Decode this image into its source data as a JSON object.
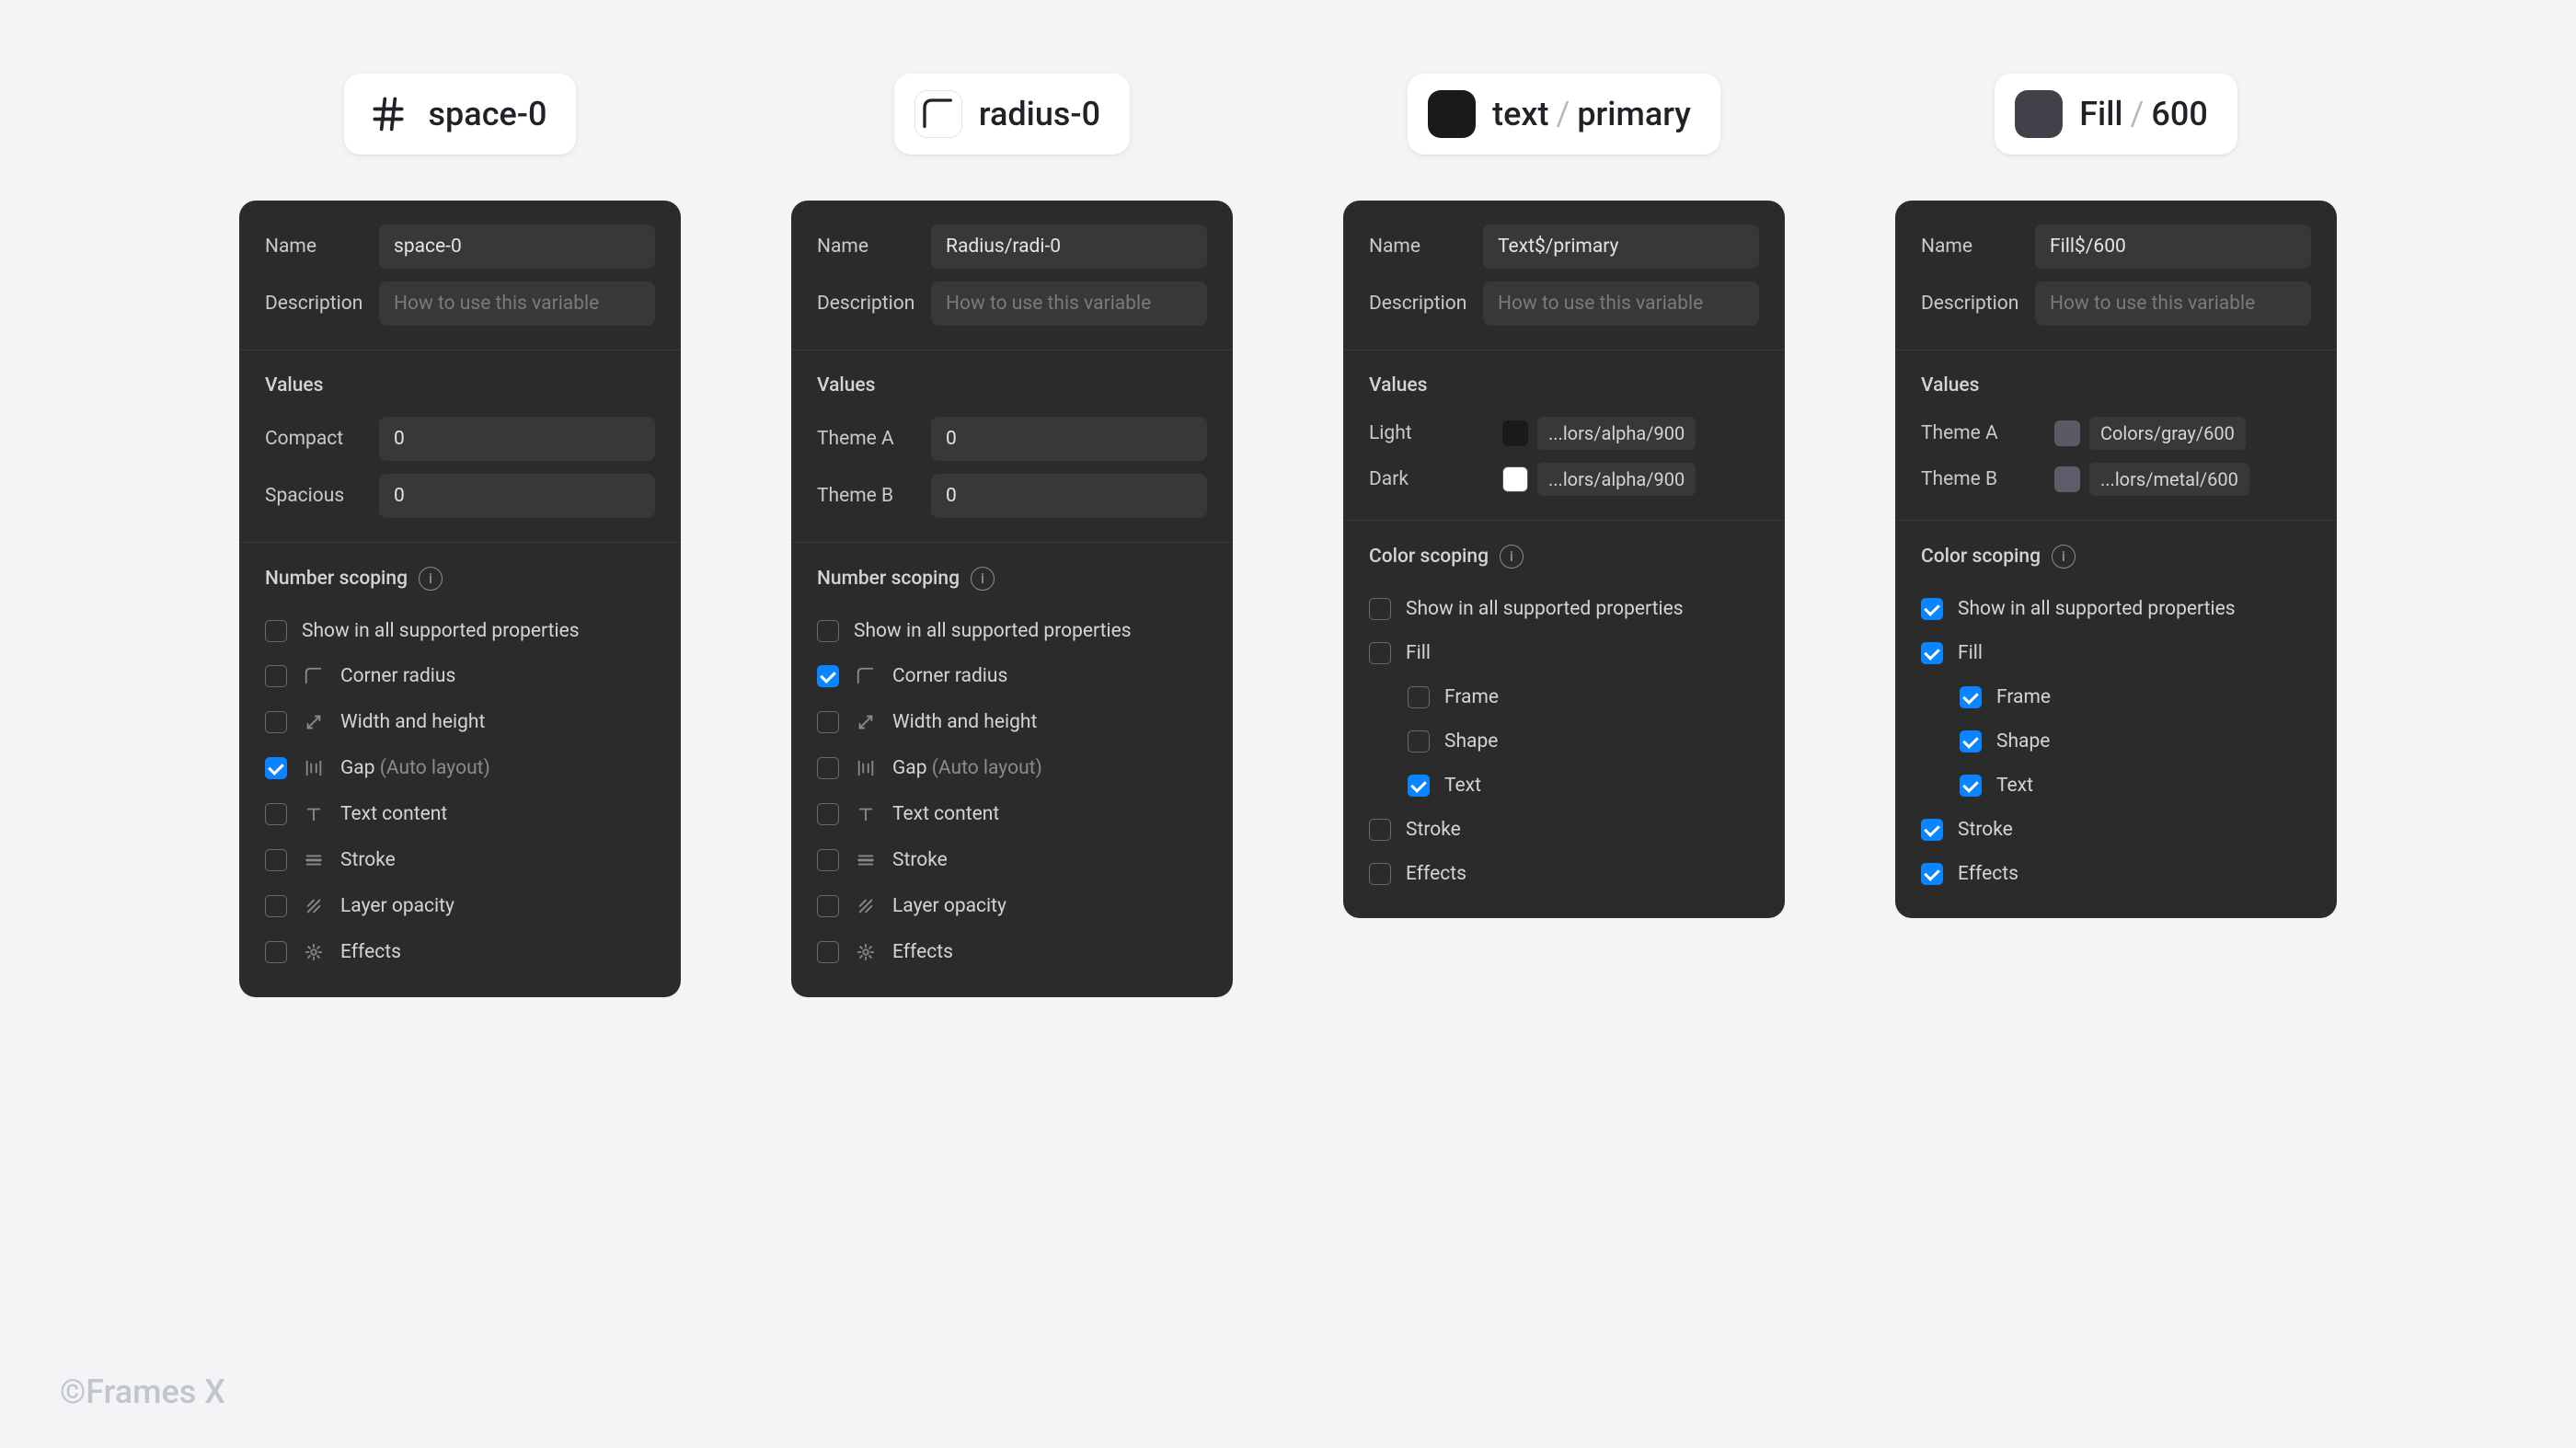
{
  "footer": "©Frames X",
  "common": {
    "nameLabel": "Name",
    "descLabel": "Description",
    "descPlaceholder": "How to use this variable",
    "valuesTitle": "Values",
    "numberScopingTitle": "Number scoping",
    "colorScopingTitle": "Color scoping",
    "showAllLabel": "Show in all supported properties",
    "cornerRadiusLabel": "Corner radius",
    "widthHeightLabel": "Width and height",
    "gapLabel": "Gap ",
    "gapMuted": "(Auto layout)",
    "textContentLabel": "Text content",
    "strokeLabel": "Stroke",
    "layerOpacityLabel": "Layer opacity",
    "effectsLabel": "Effects",
    "fillLabel": "Fill",
    "frameLabel": "Frame",
    "shapeLabel": "Shape",
    "textLabel": "Text"
  },
  "panels": [
    {
      "id": "space",
      "header": {
        "type": "hash",
        "text": "space-0"
      },
      "name": "space-0",
      "values": [
        {
          "label": "Compact",
          "value": "0"
        },
        {
          "label": "Spacious",
          "value": "0"
        }
      ],
      "scoping": {
        "kind": "number",
        "showAll": false,
        "items": [
          {
            "key": "corner",
            "checked": false
          },
          {
            "key": "wh",
            "checked": false
          },
          {
            "key": "gap",
            "checked": true
          },
          {
            "key": "tc",
            "checked": false
          },
          {
            "key": "stroke",
            "checked": false
          },
          {
            "key": "opacity",
            "checked": false
          },
          {
            "key": "effects",
            "checked": false
          }
        ]
      }
    },
    {
      "id": "radius",
      "header": {
        "type": "radius",
        "text": "radius-0"
      },
      "name": "Radius/radi-0",
      "values": [
        {
          "label": "Theme A",
          "value": "0"
        },
        {
          "label": "Theme B",
          "value": "0"
        }
      ],
      "scoping": {
        "kind": "number",
        "showAll": false,
        "items": [
          {
            "key": "corner",
            "checked": true
          },
          {
            "key": "wh",
            "checked": false
          },
          {
            "key": "gap",
            "checked": false
          },
          {
            "key": "tc",
            "checked": false
          },
          {
            "key": "stroke",
            "checked": false
          },
          {
            "key": "opacity",
            "checked": false
          },
          {
            "key": "effects",
            "checked": false
          }
        ]
      }
    },
    {
      "id": "text",
      "header": {
        "type": "swatch",
        "swatch": "#1a1a1a",
        "text": "text",
        "secondary": "primary"
      },
      "name": "Text$/primary",
      "values": [
        {
          "label": "Light",
          "swatch": "#1a1a1a",
          "chip": "...lors/alpha/900"
        },
        {
          "label": "Dark",
          "swatch": "#ffffff",
          "chip": "...lors/alpha/900"
        }
      ],
      "scoping": {
        "kind": "color",
        "showAll": false,
        "fill": false,
        "fillChildren": {
          "frame": false,
          "shape": false,
          "text": true
        },
        "stroke": false,
        "effects": false
      }
    },
    {
      "id": "fill",
      "header": {
        "type": "swatch",
        "swatch": "#414149",
        "text": "Fill",
        "secondary": "600"
      },
      "name": "Fill$/600",
      "values": [
        {
          "label": "Theme A",
          "swatch": "#5a5a62",
          "chip": "Colors/gray/600"
        },
        {
          "label": "Theme B",
          "swatch": "#5c5c6b",
          "chip": "...lors/metal/600"
        }
      ],
      "scoping": {
        "kind": "color",
        "showAll": true,
        "fill": true,
        "fillChildren": {
          "frame": true,
          "shape": true,
          "text": true
        },
        "stroke": true,
        "effects": true
      }
    }
  ]
}
